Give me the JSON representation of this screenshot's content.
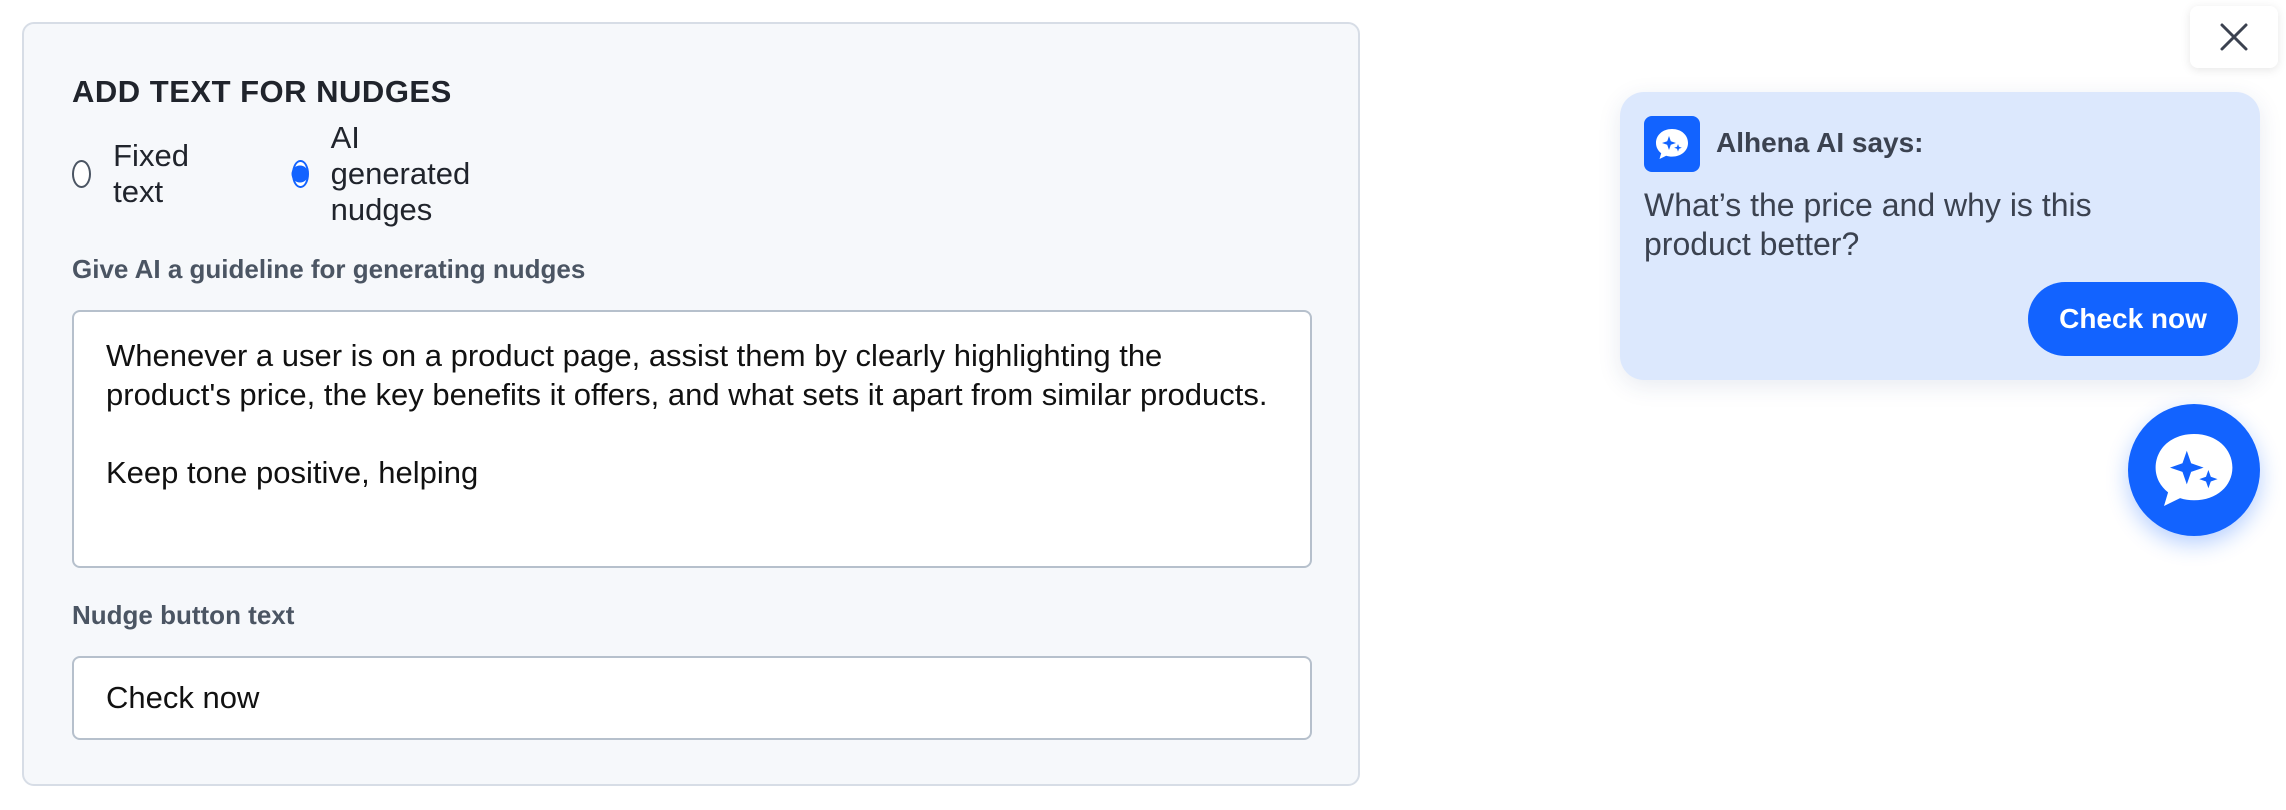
{
  "settings": {
    "title": "ADD TEXT FOR NUDGES",
    "mode_options": [
      {
        "label": "Fixed text",
        "selected": false
      },
      {
        "label": "AI generated nudges",
        "selected": true
      }
    ],
    "guideline_label": "Give AI a guideline for generating nudges",
    "guideline_value": "Whenever a user is on a product page, assist them by clearly highlighting the product's price, the key benefits it offers, and what sets it apart from similar products.\n\nKeep tone positive, helping",
    "button_text_label": "Nudge button text",
    "button_text_value": "Check now"
  },
  "preview": {
    "close_icon": "close-icon",
    "sender": "Alhena AI says:",
    "avatar_icon": "chat-sparkle-icon",
    "message": "What’s the price and why is this product better?",
    "cta_label": "Check now",
    "launcher_icon": "chat-sparkle-icon"
  },
  "colors": {
    "accent": "#1263ff",
    "nudge_background": "#dce8fd",
    "panel_background": "#f6f8fb"
  }
}
